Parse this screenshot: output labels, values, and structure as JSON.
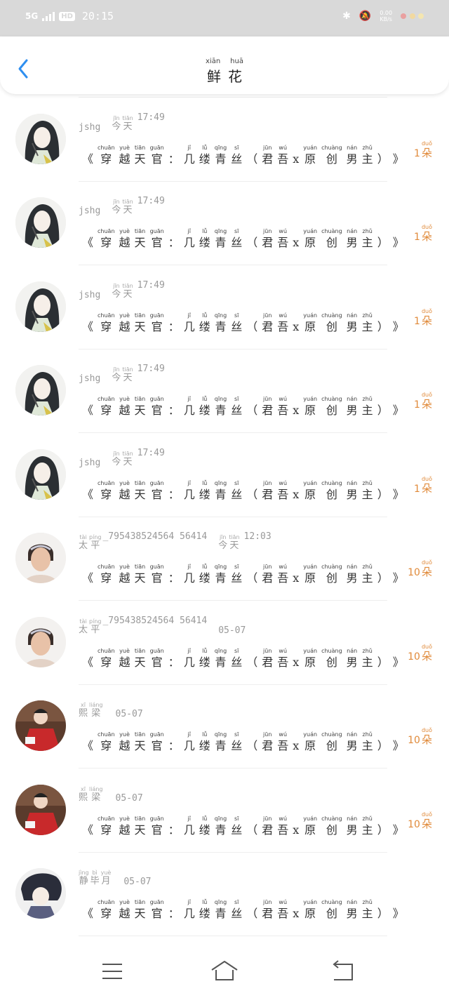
{
  "status": {
    "network": "5G",
    "hd": "HD",
    "time": "20:15",
    "speed_top": "0.00",
    "speed_bottom": "KB/s"
  },
  "header": {
    "title_pinyin": [
      "xiān",
      "huā"
    ],
    "title": [
      "鲜",
      "花"
    ]
  },
  "book_title": [
    {
      "hz": "《",
      "py": ""
    },
    {
      "hz": "穿",
      "py": "chuān"
    },
    {
      "hz": "越",
      "py": "yuè"
    },
    {
      "hz": "天",
      "py": "tiān"
    },
    {
      "hz": "官",
      "py": "guān"
    },
    {
      "hz": "：",
      "py": ""
    },
    {
      "hz": "几",
      "py": "jǐ"
    },
    {
      "hz": "缕",
      "py": "lǚ"
    },
    {
      "hz": "青",
      "py": "qīng"
    },
    {
      "hz": "丝",
      "py": "sī"
    },
    {
      "hz": "（",
      "py": ""
    },
    {
      "hz": "君",
      "py": "jūn"
    },
    {
      "hz": "吾",
      "py": "wú"
    },
    {
      "hz": "x",
      "py": ""
    },
    {
      "hz": "原",
      "py": "yuán"
    },
    {
      "hz": "创",
      "py": "chuàng"
    },
    {
      "hz": "男",
      "py": "nán"
    },
    {
      "hz": "主",
      "py": "zhǔ"
    },
    {
      "hz": "）",
      "py": ""
    },
    {
      "hz": "》",
      "py": ""
    }
  ],
  "flower_unit": {
    "py": "duǒ",
    "hz": "朵"
  },
  "rows": [
    {
      "user": "",
      "user_ruby": [],
      "date": "",
      "date_ruby": [],
      "time": "",
      "count": "1",
      "avatar": "art"
    },
    {
      "user": "jshg",
      "user_ruby": [],
      "date": "",
      "date_ruby": [
        {
          "py": "jīn",
          "hz": "今"
        },
        {
          "py": "tiān",
          "hz": "天"
        }
      ],
      "time": "17:49",
      "count": "1",
      "avatar": "art"
    },
    {
      "user": "jshg",
      "user_ruby": [],
      "date": "",
      "date_ruby": [
        {
          "py": "jīn",
          "hz": "今"
        },
        {
          "py": "tiān",
          "hz": "天"
        }
      ],
      "time": "17:49",
      "count": "1",
      "avatar": "art"
    },
    {
      "user": "jshg",
      "user_ruby": [],
      "date": "",
      "date_ruby": [
        {
          "py": "jīn",
          "hz": "今"
        },
        {
          "py": "tiān",
          "hz": "天"
        }
      ],
      "time": "17:49",
      "count": "1",
      "avatar": "art"
    },
    {
      "user": "jshg",
      "user_ruby": [],
      "date": "",
      "date_ruby": [
        {
          "py": "jīn",
          "hz": "今"
        },
        {
          "py": "tiān",
          "hz": "天"
        }
      ],
      "time": "17:49",
      "count": "1",
      "avatar": "art"
    },
    {
      "user": "jshg",
      "user_ruby": [],
      "date": "",
      "date_ruby": [
        {
          "py": "jīn",
          "hz": "今"
        },
        {
          "py": "tiān",
          "hz": "天"
        }
      ],
      "time": "17:49",
      "count": "1",
      "avatar": "art"
    },
    {
      "user": "_795438524564 56414",
      "user_ruby": [
        {
          "py": "tài",
          "hz": "太"
        },
        {
          "py": "píng",
          "hz": "平"
        }
      ],
      "date": "",
      "date_ruby": [
        {
          "py": "jīn",
          "hz": "今"
        },
        {
          "py": "tiān",
          "hz": "天"
        }
      ],
      "time": "12:03",
      "count": "10",
      "avatar": "photo"
    },
    {
      "user": "_795438524564 56414",
      "user_ruby": [
        {
          "py": "tài",
          "hz": "太"
        },
        {
          "py": "píng",
          "hz": "平"
        }
      ],
      "date": "05-07",
      "date_ruby": [],
      "time": "",
      "count": "10",
      "avatar": "photo"
    },
    {
      "user": "",
      "user_ruby": [
        {
          "py": "xī",
          "hz": "熙"
        },
        {
          "py": "liáng",
          "hz": "梁"
        }
      ],
      "date": "05-07",
      "date_ruby": [],
      "time": "",
      "count": "10",
      "avatar": "red"
    },
    {
      "user": "",
      "user_ruby": [
        {
          "py": "xī",
          "hz": "熙"
        },
        {
          "py": "liáng",
          "hz": "梁"
        }
      ],
      "date": "05-07",
      "date_ruby": [],
      "time": "",
      "count": "10",
      "avatar": "red"
    },
    {
      "user": "",
      "user_ruby": [
        {
          "py": "jìng",
          "hz": "静"
        },
        {
          "py": "bì",
          "hz": "毕"
        },
        {
          "py": "yuè",
          "hz": "月"
        }
      ],
      "date": "05-07",
      "date_ruby": [],
      "time": "",
      "count": "",
      "avatar": "art2"
    }
  ],
  "nav": {
    "menu_icon": "menu-icon",
    "home_icon": "home-icon",
    "back_icon": "back-icon"
  },
  "colors": {
    "accent": "#e08a3a",
    "back": "#2f8ff0"
  }
}
